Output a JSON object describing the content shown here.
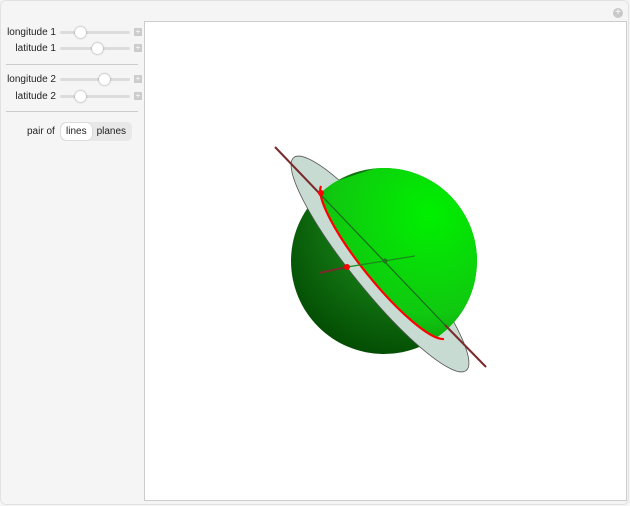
{
  "controls": {
    "sliders": [
      {
        "label": "longitude 1",
        "value": 0.28
      },
      {
        "label": "latitude 1",
        "value": 0.53
      },
      {
        "label": "longitude 2",
        "value": 0.63
      },
      {
        "label": "latitude 2",
        "value": 0.29
      }
    ],
    "pair_label": "pair of",
    "options": [
      "lines",
      "planes"
    ],
    "selected": "lines",
    "plus_icon": "+"
  },
  "colors": {
    "sphere": "#00dd00",
    "plane": "#c8dbd2",
    "circle": "#ff0000",
    "line": "#7a2a2a"
  }
}
